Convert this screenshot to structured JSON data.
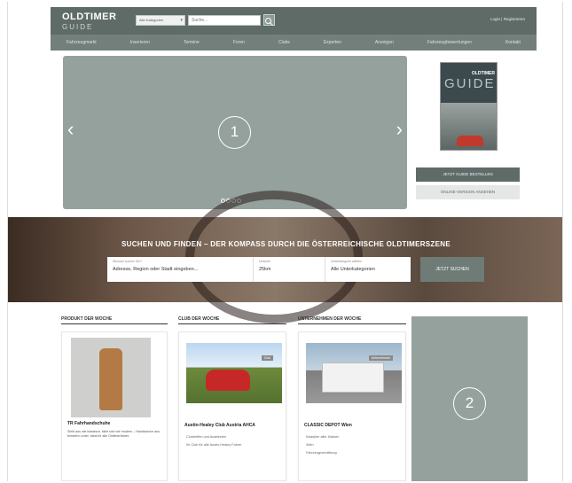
{
  "header": {
    "logo_main": "OLDTIMER",
    "logo_sub": "GUIDE",
    "category_select": "Alle Kategorien",
    "search_placeholder": "Suche...",
    "login": "Login | Registrieren"
  },
  "nav": {
    "items": [
      "Fahrzeugmarkt",
      "Inserieren",
      "Termine",
      "Foren",
      "Clubs",
      "Experten",
      "Anzeigen",
      "Fahrzeugbewertungen",
      "Kontakt"
    ]
  },
  "slider": {
    "number": "1",
    "prev": "‹",
    "next": "›",
    "dot_count": 4
  },
  "magazine": {
    "title": "OLDTIMER",
    "guide": "GUIDE",
    "order_button": "JETZT GUIDE BESTELLEN",
    "online_button": "ONLINE-VERSION ANSEHEN"
  },
  "hero": {
    "title": "SUCHEN UND FINDEN – DER KOMPASS DURCH DIE ÖSTERREICHISCHE OLDTIMERSZENE",
    "location_label": "Wonach suchen Sie?",
    "location_value": "Adresse, Region oder Stadt eingeben...",
    "radius_label": "Umkreis",
    "radius_value": "25km",
    "category_label": "Unterkategorie wählen",
    "category_value": "Alle Unterkategorien",
    "search_button": "JETZT SUCHEN"
  },
  "weekly": {
    "product_heading": "PRODUKT DER WOCHE",
    "club_heading": "CLUB DER WOCHE",
    "company_heading": "UNTERNEHMEN DER WOCHE",
    "product_title": "TR Fahrhandschuhe",
    "product_desc": "Sieht aus wie klassisch, fährt sich wie modern – Handschuhe aus feinstem Leder. Ideal für alle Oldtimerfahrer.",
    "club_title": "Austin-Healey Club Austria AHCA",
    "club_tag": "Club",
    "club_items": [
      "Clubtreffen und Ausfahrten",
      "Ihr Club für alle Austin-Healey Fahrer"
    ],
    "company_title": "CLASSIC DEPOT Wien",
    "company_tag": "Unternehmen",
    "company_items": [
      "Klassiker aller Marken",
      "Wien",
      "Fahrzeugvermittlung"
    ]
  },
  "ad": {
    "number": "2"
  }
}
